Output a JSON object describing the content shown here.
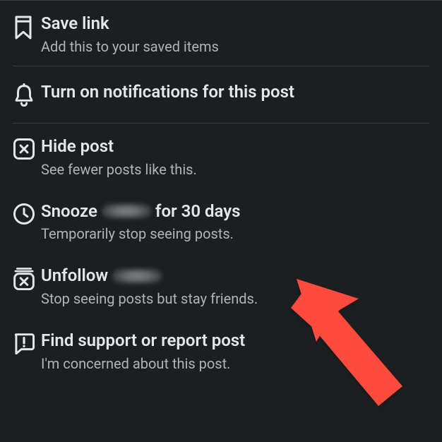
{
  "items": {
    "save": {
      "title": "Save link",
      "subtitle": "Add this to your saved items"
    },
    "notifications": {
      "title": "Turn on notifications for this post"
    },
    "hide": {
      "title": "Hide post",
      "subtitle": "See fewer posts like this."
    },
    "snooze": {
      "title_prefix": "Snooze",
      "title_suffix": "for 30 days",
      "subtitle": "Temporarily stop seeing posts."
    },
    "unfollow": {
      "title_prefix": "Unfollow",
      "subtitle": "Stop seeing posts but stay friends."
    },
    "report": {
      "title": "Find support or report post",
      "subtitle": "I'm concerned about this post."
    }
  },
  "colors": {
    "arrow": "#ff4b3e"
  }
}
